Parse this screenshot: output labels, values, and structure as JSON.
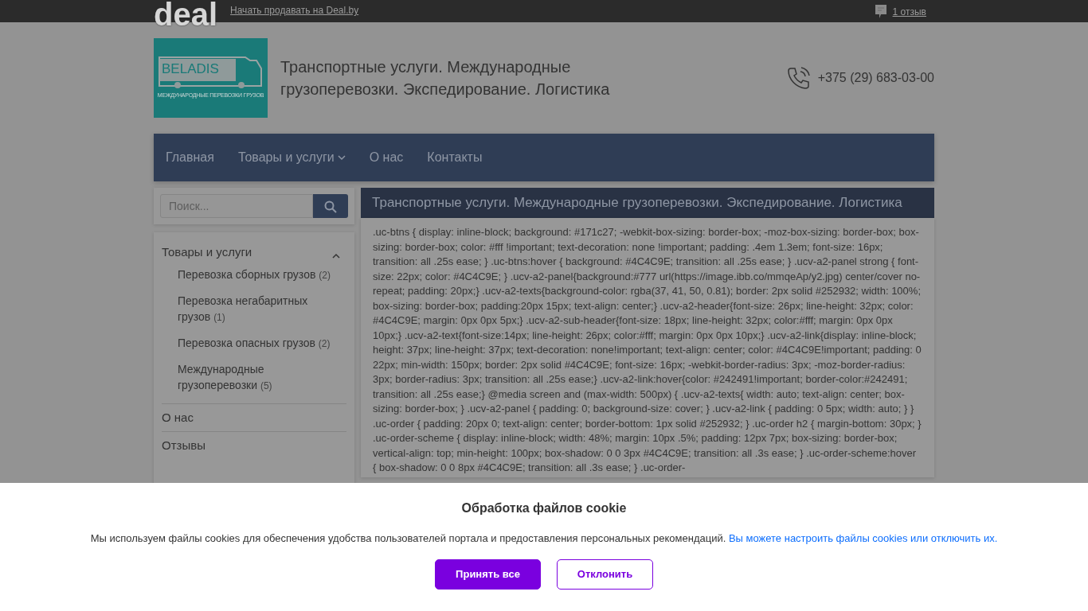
{
  "top_bar": {
    "logo": "deal",
    "sell_link": "Начать продавать на Deal.by",
    "reviews_link": "1 отзыв"
  },
  "header": {
    "logo_name": "BELADIS",
    "logo_tagline": "МЕЖДУНАРОДНЫЕ ПЕРЕВОЗКИ ГРУЗОВ",
    "title": "Транспортные услуги. Международные грузоперевозки. Экспедирование. Логистика",
    "phone": "+375 (29) 683-03-00"
  },
  "nav": [
    {
      "label": "Главная",
      "dropdown": false
    },
    {
      "label": "Товары и услуги",
      "dropdown": true
    },
    {
      "label": "О нас",
      "dropdown": false
    },
    {
      "label": "Контакты",
      "dropdown": false
    }
  ],
  "search": {
    "placeholder": "Поиск..."
  },
  "sidebar": {
    "items": [
      {
        "label": "Товары и услуги",
        "kind": "group",
        "expanded": true,
        "children": [
          {
            "label": "Перевозка сборных грузов",
            "count": "(2)"
          },
          {
            "label": "Перевозка негабаритных грузов",
            "count": "(1)"
          },
          {
            "label": "Перевозка опасных грузов",
            "count": "(2)"
          },
          {
            "label": "Международные грузоперевозки",
            "count": "(5)"
          }
        ]
      },
      {
        "label": "О нас",
        "kind": "link"
      },
      {
        "label": "Отзывы",
        "kind": "link"
      }
    ]
  },
  "content": {
    "title": "Транспортные услуги. Международные грузоперевозки. Экспедирование. Логистика",
    "text": ".uc-btns { display: inline-block; background: #171c27; -webkit-box-sizing: border-box; -moz-box-sizing: border-box; box-sizing: border-box; color: #fff !important; text-decoration: none !important; padding: .4em 1.3em; font-size: 16px; transition: all .25s ease; } .uc-btns:hover { background: #4C4C9E; transition: all .25s ease; } .ucv-a2-panel strong { font-size: 22px; color: #4C4C9E; } .ucv-a2-panel{background:#777 url(https://image.ibb.co/mmqeAp/y2.jpg) center/cover no-repeat; padding: 20px;} .ucv-a2-texts{background-color: rgba(37, 41, 50, 0.81); border: 2px solid #252932; width: 100%; box-sizing: border-box; padding:20px 15px; text-align: center;} .ucv-a2-header{font-size: 26px; line-height: 32px; color: #4C4C9E; margin: 0px 0px 5px;} .ucv-a2-sub-header{font-size: 18px; line-height: 32px; color:#fff; margin: 0px 0px 10px;} .ucv-a2-text{font-size:14px; line-height: 26px; color:#fff; margin: 0px 0px 10px;} .ucv-a2-link{display: inline-block; height: 37px; line-height: 37px; text-decoration: none!important; text-align: center; color: #4C4C9E!important; padding: 0 22px; min-width: 150px; border: 2px solid #4C4C9E; font-size: 16px; -webkit-border-radius: 3px; -moz-border-radius: 3px; border-radius: 3px; transition: all .25s ease;} .ucv-a2-link:hover{color: #242491!important; border-color:#242491; transition: all .25s ease;} @media screen and (max-width: 500px) { .ucv-a2-texts{ width: auto; text-align: center; box-sizing: border-box; } .ucv-a2-panel { padding: 0; background-size: cover; } .ucv-a2-link { padding: 0 5px; width: auto; } } .uc-order { padding: 20px 0; text-align: center; border-bottom: 1px solid #252932; } .uc-order h2 { margin-bottom: 30px; } .uc-order-scheme { display: inline-block; width: 48%; margin: 10px .5%; padding: 12px 7px; box-sizing: border-box; vertical-align: top; min-height: 100px; box-shadow: 0 0 3px #4C4C9E; transition: all .3s ease; } .uc-order-scheme:hover { box-shadow: 0 0 8px #4C4C9E; transition: all .3s ease; } .uc-order-"
  },
  "cookie_banner": {
    "title": "Обработка файлов cookie",
    "text": "Мы используем файлы cookies для обеспечения удобства пользователей портала и предоставления персональных рекомендаций.",
    "link": "Вы можете настроить файлы cookies или отключить их.",
    "buttons": [
      {
        "label": "Принять все",
        "kind": "primary"
      },
      {
        "label": "Отклонить",
        "kind": "outline"
      }
    ]
  }
}
